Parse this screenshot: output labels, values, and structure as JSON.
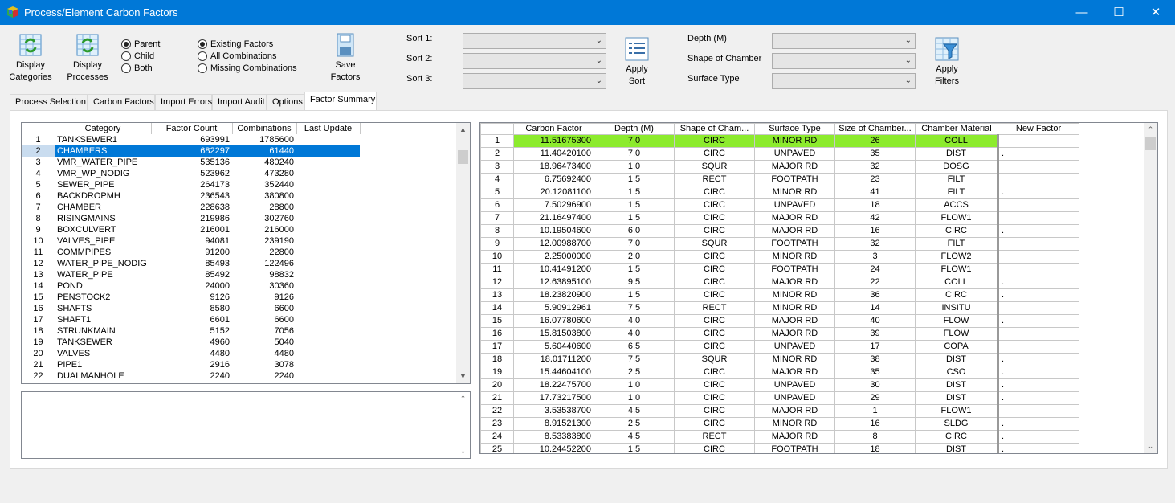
{
  "window": {
    "title": "Process/Element Carbon Factors",
    "minimize": "—",
    "maximize": "☐",
    "close": "✕"
  },
  "toolbar": {
    "display_categories": "Display Categories",
    "display_processes": "Display Processes",
    "save_factors": "Save Factors",
    "apply_sort": "Apply Sort",
    "apply_filters": "Apply Filters",
    "level_options": [
      {
        "label": "Parent",
        "selected": true
      },
      {
        "label": "Child",
        "selected": false
      },
      {
        "label": "Both",
        "selected": false
      }
    ],
    "scope_options": [
      {
        "label": "Existing Factors",
        "selected": true
      },
      {
        "label": "All Combinations",
        "selected": false
      },
      {
        "label": "Missing Combinations",
        "selected": false
      }
    ],
    "sort_labels": [
      "Sort 1:",
      "Sort 2:",
      "Sort 3:"
    ],
    "filter_labels": [
      "Depth (M)",
      "Shape of Chamber",
      "Surface Type"
    ]
  },
  "tabs": [
    {
      "label": "Process Selection",
      "active": false
    },
    {
      "label": "Carbon Factors",
      "active": false
    },
    {
      "label": "Import Errors",
      "active": false
    },
    {
      "label": "Import Audit",
      "active": false
    },
    {
      "label": "Options",
      "active": false
    },
    {
      "label": "Factor Summary",
      "active": true
    }
  ],
  "category_grid": {
    "columns": [
      "",
      "Category",
      "Factor Count",
      "Combinations",
      "Last Update"
    ],
    "selected_row": 2,
    "rows": [
      [
        "1",
        "TANKSEWER1",
        "693991",
        "1785600",
        ""
      ],
      [
        "2",
        "CHAMBERS",
        "682297",
        "61440",
        ""
      ],
      [
        "3",
        "VMR_WATER_PIPE",
        "535136",
        "480240",
        ""
      ],
      [
        "4",
        "VMR_WP_NODIG",
        "523962",
        "473280",
        ""
      ],
      [
        "5",
        "SEWER_PIPE",
        "264173",
        "352440",
        ""
      ],
      [
        "6",
        "BACKDROPMH",
        "236543",
        "380800",
        ""
      ],
      [
        "7",
        "CHAMBER",
        "228638",
        "28800",
        ""
      ],
      [
        "8",
        "RISINGMAINS",
        "219986",
        "302760",
        ""
      ],
      [
        "9",
        "BOXCULVERT",
        "216001",
        "216000",
        ""
      ],
      [
        "10",
        "VALVES_PIPE",
        "94081",
        "239190",
        ""
      ],
      [
        "11",
        "COMMPIPES",
        "91200",
        "22800",
        ""
      ],
      [
        "12",
        "WATER_PIPE_NODIG",
        "85493",
        "122496",
        ""
      ],
      [
        "13",
        "WATER_PIPE",
        "85492",
        "98832",
        ""
      ],
      [
        "14",
        "POND",
        "24000",
        "30360",
        ""
      ],
      [
        "15",
        "PENSTOCK2",
        "9126",
        "9126",
        ""
      ],
      [
        "16",
        "SHAFTS",
        "8580",
        "6600",
        ""
      ],
      [
        "17",
        "SHAFT1",
        "6601",
        "6600",
        ""
      ],
      [
        "18",
        "STRUNKMAIN",
        "5152",
        "7056",
        ""
      ],
      [
        "19",
        "TANKSEWER",
        "4960",
        "5040",
        ""
      ],
      [
        "20",
        "VALVES",
        "4480",
        "4480",
        ""
      ],
      [
        "21",
        "PIPE1",
        "2916",
        "3078",
        ""
      ],
      [
        "22",
        "DUALMANHOLE",
        "2240",
        "2240",
        ""
      ]
    ]
  },
  "factor_grid": {
    "columns": [
      "",
      "Carbon Factor",
      "Depth (M)",
      "Shape of Cham...",
      "Surface Type",
      "Size of Chamber...",
      "Chamber Material",
      "New Factor"
    ],
    "highlight_row": 1,
    "highlight_color": "#8ceb2d",
    "rows": [
      [
        "1",
        "11.51675300",
        "7.0",
        "CIRC",
        "MINOR RD",
        "26",
        "COLL",
        ""
      ],
      [
        "2",
        "11.40420100",
        "7.0",
        "CIRC",
        "UNPAVED",
        "35",
        "DIST",
        "."
      ],
      [
        "3",
        "18.96473400",
        "1.0",
        "SQUR",
        "MAJOR RD",
        "32",
        "DOSG",
        ""
      ],
      [
        "4",
        "6.75692400",
        "1.5",
        "RECT",
        "FOOTPATH",
        "23",
        "FILT",
        ""
      ],
      [
        "5",
        "20.12081100",
        "1.5",
        "CIRC",
        "MINOR RD",
        "41",
        "FILT",
        "."
      ],
      [
        "6",
        "7.50296900",
        "1.5",
        "CIRC",
        "UNPAVED",
        "18",
        "ACCS",
        ""
      ],
      [
        "7",
        "21.16497400",
        "1.5",
        "CIRC",
        "MAJOR RD",
        "42",
        "FLOW1",
        ""
      ],
      [
        "8",
        "10.19504600",
        "6.0",
        "CIRC",
        "MAJOR RD",
        "16",
        "CIRC",
        "."
      ],
      [
        "9",
        "12.00988700",
        "7.0",
        "SQUR",
        "FOOTPATH",
        "32",
        "FILT",
        ""
      ],
      [
        "10",
        "2.25000000",
        "2.0",
        "CIRC",
        "MINOR RD",
        "3",
        "FLOW2",
        ""
      ],
      [
        "11",
        "10.41491200",
        "1.5",
        "CIRC",
        "FOOTPATH",
        "24",
        "FLOW1",
        ""
      ],
      [
        "12",
        "12.63895100",
        "9.5",
        "CIRC",
        "MAJOR RD",
        "22",
        "COLL",
        "."
      ],
      [
        "13",
        "18.23820900",
        "1.5",
        "CIRC",
        "MINOR RD",
        "36",
        "CIRC",
        "."
      ],
      [
        "14",
        "5.90912961",
        "7.5",
        "RECT",
        "MINOR RD",
        "14",
        "INSITU",
        ""
      ],
      [
        "15",
        "16.07780600",
        "4.0",
        "CIRC",
        "MAJOR RD",
        "40",
        "FLOW",
        "."
      ],
      [
        "16",
        "15.81503800",
        "4.0",
        "CIRC",
        "MAJOR RD",
        "39",
        "FLOW",
        ""
      ],
      [
        "17",
        "5.60440600",
        "6.5",
        "CIRC",
        "UNPAVED",
        "17",
        "COPA",
        ""
      ],
      [
        "18",
        "18.01711200",
        "7.5",
        "SQUR",
        "MINOR RD",
        "38",
        "DIST",
        "."
      ],
      [
        "19",
        "15.44604100",
        "2.5",
        "CIRC",
        "MAJOR RD",
        "35",
        "CSO",
        "."
      ],
      [
        "20",
        "18.22475700",
        "1.0",
        "CIRC",
        "UNPAVED",
        "30",
        "DIST",
        "."
      ],
      [
        "21",
        "17.73217500",
        "1.0",
        "CIRC",
        "UNPAVED",
        "29",
        "DIST",
        "."
      ],
      [
        "22",
        "3.53538700",
        "4.5",
        "CIRC",
        "MAJOR RD",
        "1",
        "FLOW1",
        ""
      ],
      [
        "23",
        "8.91521300",
        "2.5",
        "CIRC",
        "MINOR RD",
        "16",
        "SLDG",
        "."
      ],
      [
        "24",
        "8.53383800",
        "4.5",
        "RECT",
        "MAJOR RD",
        "8",
        "CIRC",
        "."
      ],
      [
        "25",
        "10.24452200",
        "1.5",
        "CIRC",
        "FOOTPATH",
        "18",
        "DIST",
        "."
      ]
    ]
  }
}
